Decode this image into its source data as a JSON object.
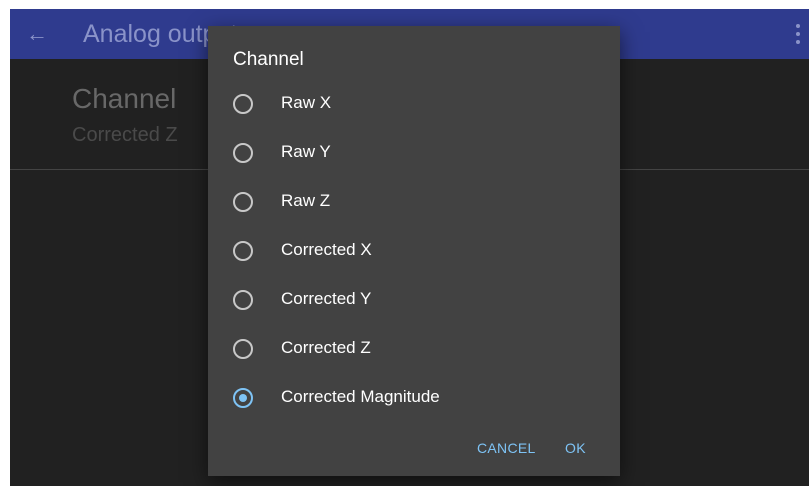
{
  "appbar": {
    "back_icon": "arrow-left-icon",
    "title": "Analog output",
    "overflow_icon": "more-vertical-icon"
  },
  "preference": {
    "title": "Channel",
    "summary": "Corrected Z"
  },
  "dialog": {
    "title": "Channel",
    "options": [
      {
        "label": "Raw X",
        "selected": false
      },
      {
        "label": "Raw Y",
        "selected": false
      },
      {
        "label": "Raw Z",
        "selected": false
      },
      {
        "label": "Corrected X",
        "selected": false
      },
      {
        "label": "Corrected Y",
        "selected": false
      },
      {
        "label": "Corrected Z",
        "selected": false
      },
      {
        "label": "Corrected Magnitude",
        "selected": true
      }
    ],
    "cancel_label": "CANCEL",
    "ok_label": "OK"
  },
  "colors": {
    "appbar": "#2f3b8e",
    "background": "#212121",
    "dialog": "#424242",
    "accent": "#7ec3f5"
  }
}
